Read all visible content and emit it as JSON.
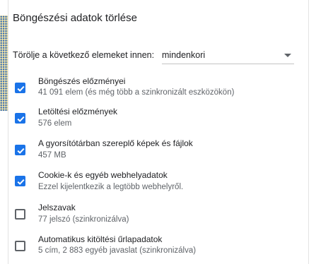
{
  "dialog": {
    "title": "Böngészési adatok törlése"
  },
  "time_range": {
    "label": "Törölje a következő elemeket innen:",
    "selected": "mindenkori"
  },
  "items": [
    {
      "title": "Böngészés előzményei",
      "subtitle": "41 091 elem (és még több a szinkronizált eszközökön)",
      "checked": true
    },
    {
      "title": "Letöltési előzmények",
      "subtitle": "576 elem",
      "checked": true
    },
    {
      "title": "A gyorsítótárban szereplő képek és fájlok",
      "subtitle": "457 MB",
      "checked": true
    },
    {
      "title": "Cookie-k és egyéb webhelyadatok",
      "subtitle": "Ezzel kijelentkezik a legtöbb webhelyről.",
      "checked": true
    },
    {
      "title": "Jelszavak",
      "subtitle": "77 jelszó (szinkronizálva)",
      "checked": false
    },
    {
      "title": "Automatikus kitöltési űrlapadatok",
      "subtitle": "5 cím, 2 883 egyéb javaslat (szinkronizálva)",
      "checked": false
    }
  ],
  "colors": {
    "accent": "#1a73e8",
    "text": "#202124",
    "secondary_text": "#5f6368"
  }
}
